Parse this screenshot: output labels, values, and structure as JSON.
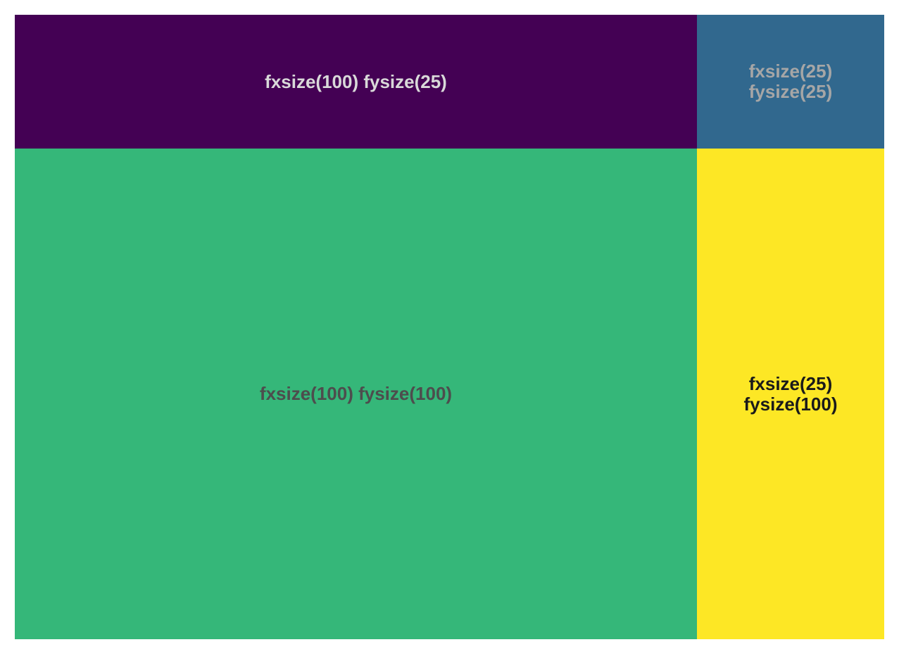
{
  "tiles": [
    {
      "label": "fxsize(100) fysize(25)",
      "fill": "#440154",
      "text_color": "#d9d9d9",
      "width_value": 100,
      "height_value": 25
    },
    {
      "label": "fxsize(25) fysize(25)",
      "fill": "#31688e",
      "text_color": "#a6a6a6",
      "width_value": 25,
      "height_value": 25
    },
    {
      "label": "fxsize(100) fysize(100)",
      "fill": "#35b779",
      "text_color": "#4d4d4d",
      "width_value": 100,
      "height_value": 100
    },
    {
      "label": "fxsize(25) fysize(100)",
      "fill": "#fde725",
      "text_color": "#1a1a1a",
      "width_value": 25,
      "height_value": 100
    }
  ]
}
